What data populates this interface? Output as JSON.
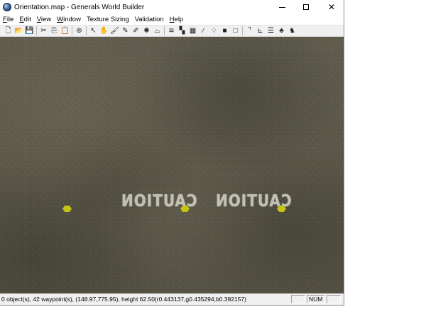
{
  "window": {
    "title": "Orientation.map - Generals World Builder"
  },
  "menu": [
    {
      "label": "File",
      "mnemonic": "F",
      "rest": "ile"
    },
    {
      "label": "Edit",
      "mnemonic": "E",
      "rest": "dit"
    },
    {
      "label": "View",
      "mnemonic": "V",
      "rest": "iew"
    },
    {
      "label": "Window",
      "mnemonic": "W",
      "rest": "indow"
    },
    {
      "label": "Texture Sizing",
      "mnemonic": "",
      "rest": "Texture Sizing"
    },
    {
      "label": "Validation",
      "mnemonic": "",
      "rest": "Validation"
    },
    {
      "label": "Help",
      "mnemonic": "H",
      "rest": "elp"
    }
  ],
  "toolbar": {
    "icons": [
      {
        "name": "new-file-icon",
        "glyph": "🗋"
      },
      {
        "name": "open-folder-icon",
        "glyph": "📂"
      },
      {
        "name": "save-icon",
        "glyph": "💾"
      },
      {
        "sep": true
      },
      {
        "name": "cut-icon",
        "glyph": "✂"
      },
      {
        "name": "copy-icon",
        "glyph": "⎘"
      },
      {
        "name": "paste-icon",
        "glyph": "📋"
      },
      {
        "sep": true
      },
      {
        "name": "object-properties-icon",
        "glyph": "⊚"
      },
      {
        "sep": true
      },
      {
        "name": "pointer-icon",
        "glyph": "↖"
      },
      {
        "name": "hand-move-icon",
        "glyph": "✋"
      },
      {
        "name": "brush-icon",
        "glyph": "🖌"
      },
      {
        "name": "feather-brush-icon",
        "glyph": "✎"
      },
      {
        "name": "tile-paint-icon",
        "glyph": "✐"
      },
      {
        "name": "sparkle-icon",
        "glyph": "✺"
      },
      {
        "name": "mound-icon",
        "glyph": "⌓"
      },
      {
        "sep": true
      },
      {
        "name": "water-icon",
        "glyph": "≋"
      },
      {
        "name": "checkerboard-icon",
        "glyph": "▚"
      },
      {
        "name": "grid-icon",
        "glyph": "▦"
      },
      {
        "name": "eyedropper-icon",
        "glyph": "⁄"
      },
      {
        "name": "fill-bucket-icon",
        "glyph": "♢"
      },
      {
        "name": "black-square-icon",
        "glyph": "■"
      },
      {
        "name": "outline-square-icon",
        "glyph": "□"
      },
      {
        "sep": true
      },
      {
        "name": "corner-icon",
        "glyph": "⌝"
      },
      {
        "name": "axis-icon",
        "glyph": "⊾"
      },
      {
        "name": "road-icon",
        "glyph": "☰"
      },
      {
        "name": "tree-icon",
        "glyph": "♣"
      },
      {
        "name": "waypoint-icon",
        "glyph": "♞"
      }
    ]
  },
  "viewport": {
    "decals": [
      "CAUTION",
      "CAUTION"
    ],
    "waypoint_color": "#c6c412"
  },
  "status": {
    "text": "0 object(s), 42 waypoint(s), (148.97,775.95), height 62.50(r0.443137,g0.435294,b0.392157)",
    "pane1": "",
    "pane2": "NUM",
    "pane3": ""
  }
}
